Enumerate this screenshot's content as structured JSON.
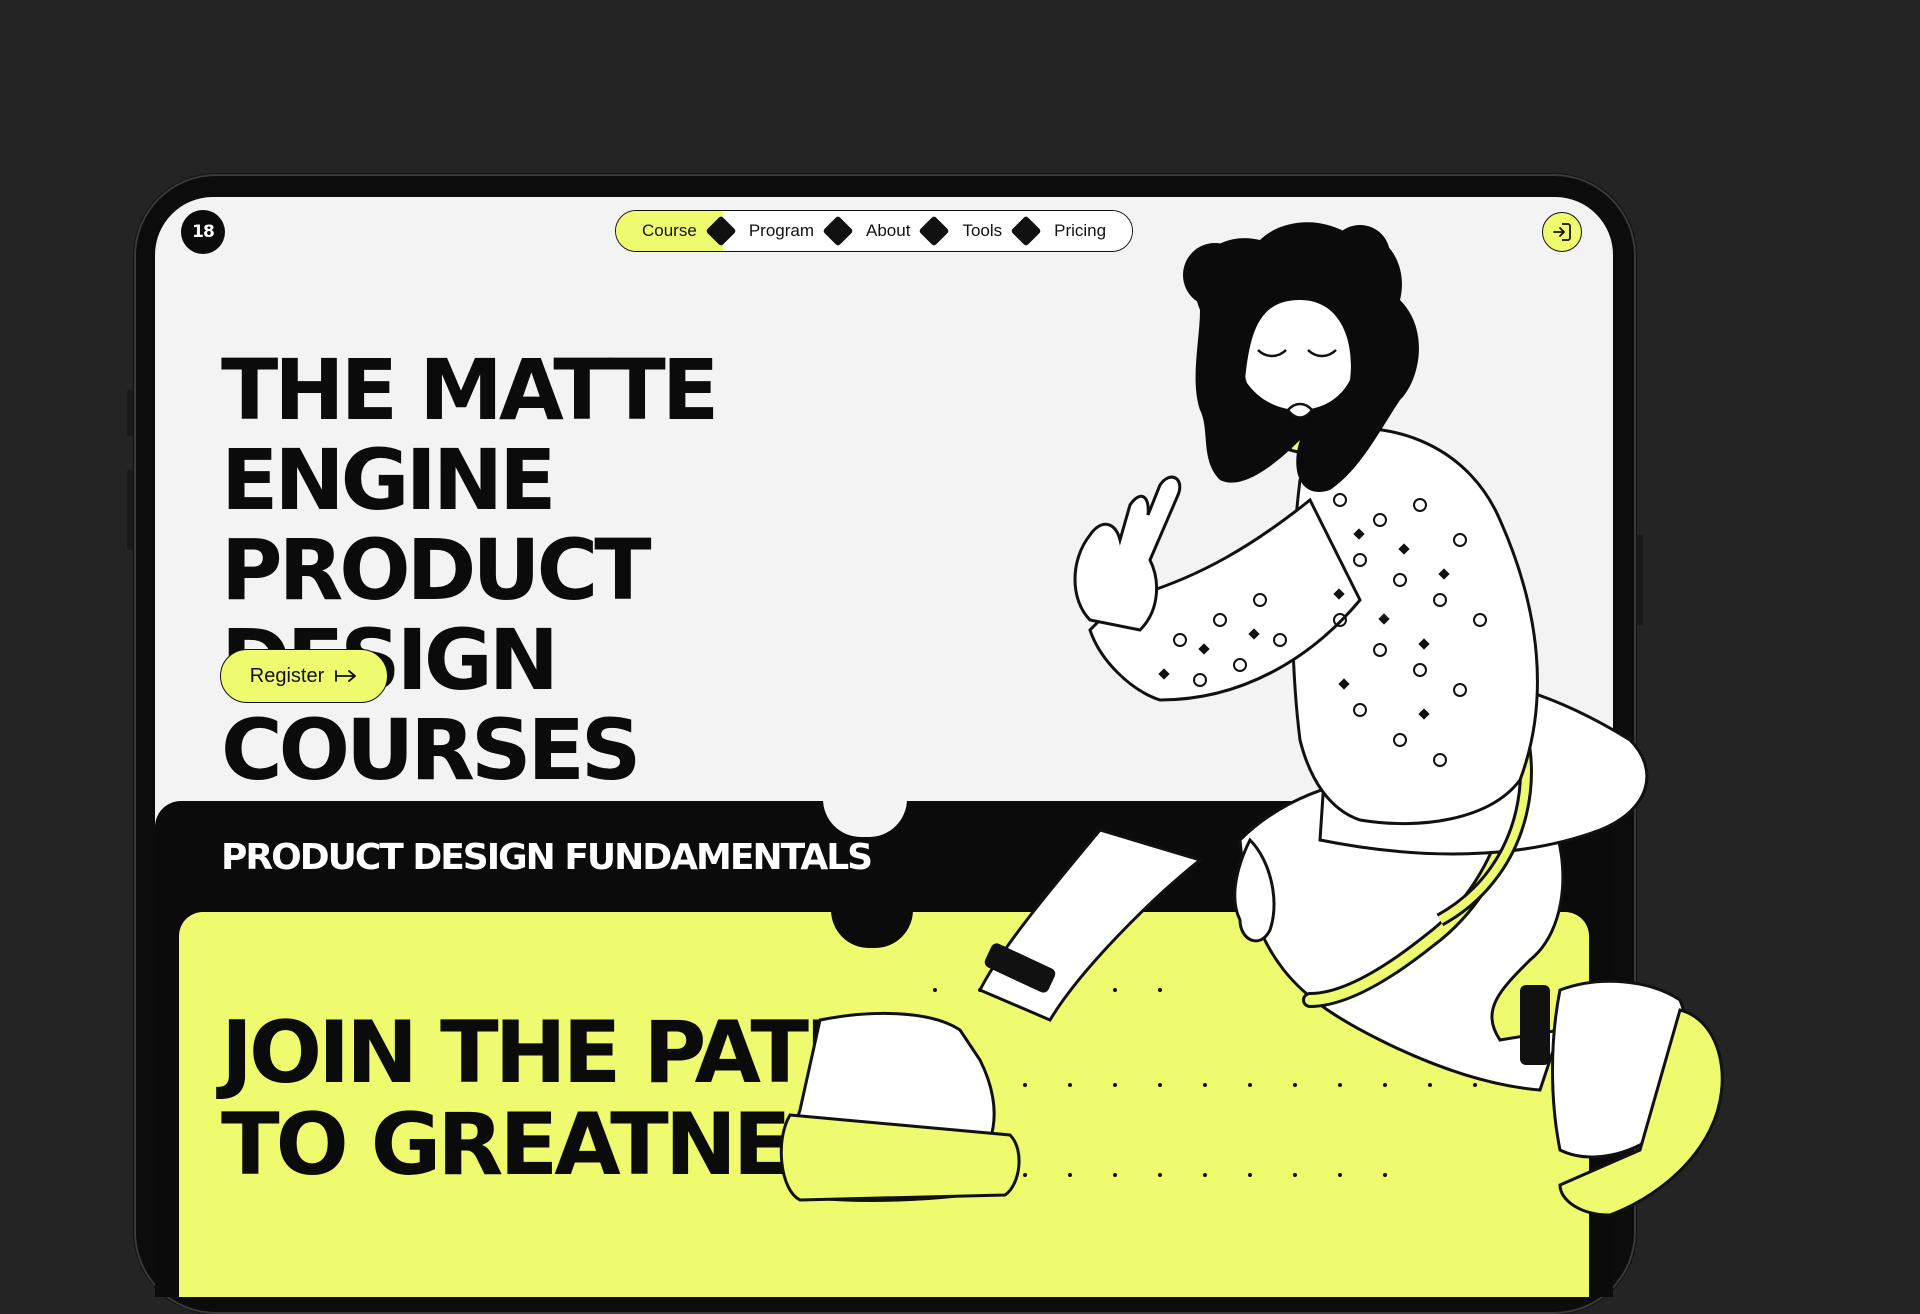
{
  "brand": {
    "logo_text": "18"
  },
  "nav": {
    "items": [
      {
        "label": "Course",
        "active": true
      },
      {
        "label": "Program",
        "active": false
      },
      {
        "label": "About",
        "active": false
      },
      {
        "label": "Tools",
        "active": false
      },
      {
        "label": "Pricing",
        "active": false
      }
    ]
  },
  "hero": {
    "title_lines": [
      "THE MATTE ENGINE",
      "PRODUCT DESIGN",
      "COURSES"
    ],
    "register_label": "Register"
  },
  "section": {
    "title": "PRODUCT DESIGN FUNDAMENTALS"
  },
  "card": {
    "title_lines": [
      "JOIN THE PATH",
      "TO GREATNESS"
    ]
  },
  "colors": {
    "background": "#242424",
    "screen": "#f3f3f3",
    "accent": "#eefb6e",
    "ink": "#0b0b0b"
  },
  "icons": {
    "login": "login-icon",
    "register_arrow": "arrow-right-icon"
  }
}
